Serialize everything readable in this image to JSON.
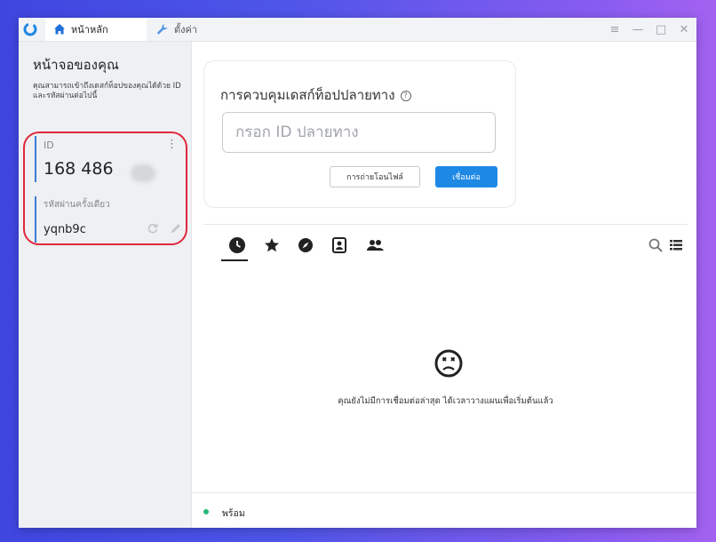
{
  "titlebar": {
    "tabs": [
      {
        "label": "หน้าหลัก",
        "icon": "home-icon"
      },
      {
        "label": "ตั้งค่า",
        "icon": "wrench-icon"
      }
    ],
    "controls": [
      "menu-icon",
      "minimize-icon",
      "maximize-icon",
      "close-icon"
    ]
  },
  "sidebar": {
    "title": "หน้าจอของคุณ",
    "description": "คุณสามารถเข้าถึงเดสก์ท็อปของคุณได้ด้วย ID และรหัสผ่านต่อไปนี้",
    "id_label": "ID",
    "id_value": "168 486",
    "password_label": "รหัสผ่านครั้งเดียว",
    "password_value": "yqnb9c"
  },
  "control_card": {
    "title": "การควบคุมเดสก์ท็อปปลายทาง",
    "input_placeholder": "กรอก ID ปลายทาง",
    "file_transfer_label": "การถ่ายโอนไฟล์",
    "connect_label": "เชื่อมต่อ"
  },
  "peer_tabs": [
    "recent-icon",
    "star-icon",
    "compass-icon",
    "address-book-icon",
    "group-icon"
  ],
  "empty_state": {
    "message": "คุณยังไม่มีการเชื่อมต่อล่าสุด ได้เวลาวางแผนเพื่อเริ่มต้นแล้ว"
  },
  "status": {
    "text": "พร้อม",
    "color": "#28b67a"
  },
  "colors": {
    "accent": "#1e88e5",
    "highlight": "#e0283b"
  }
}
